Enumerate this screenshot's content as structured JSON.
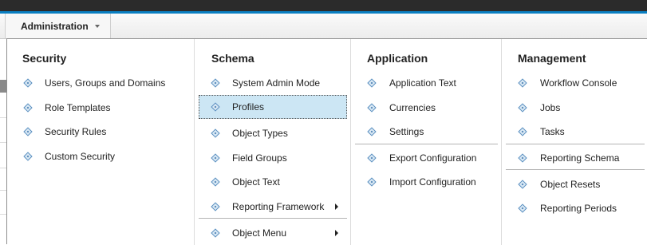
{
  "menubar": {
    "admin_label": "Administration"
  },
  "dropdown": {
    "security": {
      "title": "Security",
      "items": [
        "Users, Groups and Domains",
        "Role Templates",
        "Security Rules",
        "Custom Security"
      ]
    },
    "schema": {
      "title": "Schema",
      "items": [
        "System Admin Mode",
        "Profiles",
        "Object Types",
        "Field Groups",
        "Object Text",
        "Reporting Framework",
        "Object Menu"
      ],
      "selected": "Profiles"
    },
    "application": {
      "title": "Application",
      "items": [
        "Application Text",
        "Currencies",
        "Settings",
        "Export Configuration",
        "Import Configuration"
      ]
    },
    "management": {
      "title": "Management",
      "items": [
        "Workflow Console",
        "Jobs",
        "Tasks",
        "Reporting Schema",
        "Object Resets",
        "Reporting Periods"
      ]
    }
  },
  "colors": {
    "accent": "#0a7fc1",
    "selected_bg": "#cce6f4",
    "topbar": "#2b2b2b"
  },
  "icons": {
    "item": "diamond-icon",
    "submenu": "arrow-right-icon",
    "dropdown": "caret-down-icon"
  }
}
